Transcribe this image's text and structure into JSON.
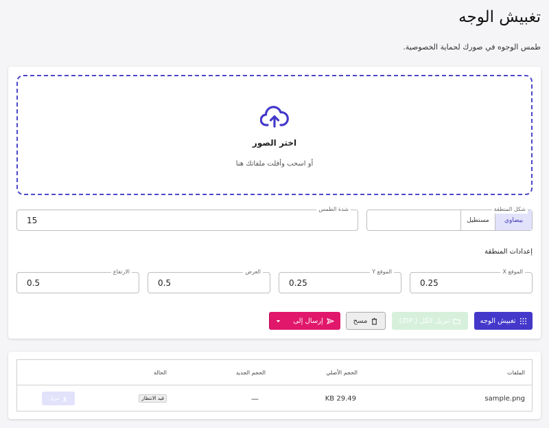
{
  "header": {
    "title": "تغبيش الوجه",
    "subtitle": "طمس الوجوه في صورك لحماية الخصوصية."
  },
  "dropzone": {
    "icon": "cloud-upload-icon",
    "choose_label": "اختر الصور",
    "drag_label": "أو اسحب وأفلت ملفاتك هنا"
  },
  "controls": {
    "shape": {
      "label": "شكل المنطقة",
      "options": [
        "بيضاوي",
        "مستطيل"
      ],
      "selected": "بيضاوي"
    },
    "strength": {
      "label": "شدة الطمس",
      "value": "15"
    },
    "region_label": "إعدادات المنطقة",
    "pos_x": {
      "label": "الموقع X",
      "value": "0.25"
    },
    "pos_y": {
      "label": "الموقع Y",
      "value": "0.25"
    },
    "width": {
      "label": "العرض",
      "value": "0.5"
    },
    "height": {
      "label": "الارتفاع",
      "value": "0.5"
    }
  },
  "actions": {
    "blur_label": "تغبيش الوجه",
    "zip_label": "تنزيل الكل (.ZIP)",
    "clear_label": "مسح",
    "send_label": "إرسال إلى"
  },
  "table": {
    "headers": {
      "file": "الملفات",
      "original_size": "الحجم الأصلي",
      "new_size": "الحجم الجديد",
      "status": "الحالة"
    },
    "rows": [
      {
        "file": "sample.png",
        "original_size": "29.49 KB",
        "new_size": "—",
        "status": "قيد الانتظار",
        "download_label": "تنزيل"
      }
    ]
  },
  "colors": {
    "primary": "#4338ca",
    "accent": "#e0176a",
    "zip_disabled": "#d6f0dc"
  }
}
